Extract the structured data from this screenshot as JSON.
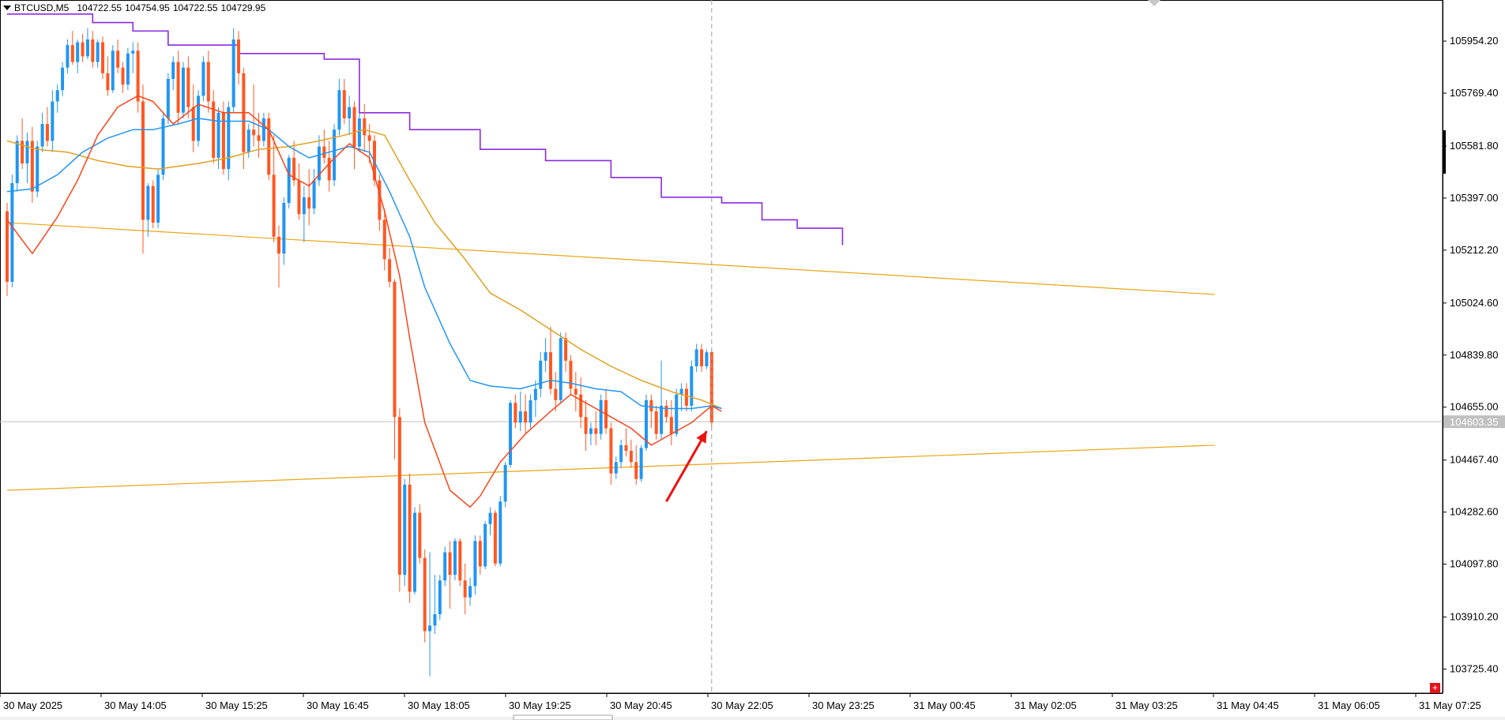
{
  "header": {
    "symbol_timeframe": "BTCUSD,M5",
    "open": "104722.55",
    "high": "104754.95",
    "low": "104722.55",
    "close": "104729.95"
  },
  "colors": {
    "bull": "#2196f3",
    "bear": "#ff5722",
    "ma_fast": "#f7451b",
    "ma_mid": "#2196f3",
    "ma_slow": "#e0a020",
    "trendline": "#e8a614",
    "step_line": "#8a2be2",
    "arrow": "#ee1111",
    "price_line": "#c0c0c0",
    "grid": "#000000"
  },
  "chart_data": {
    "type": "candlestick",
    "symbol": "BTCUSD",
    "timeframe": "M5",
    "ylim": [
      103640,
      106100
    ],
    "price_ticks": [
      "105954.20",
      "105769.40",
      "105581.80",
      "105397.00",
      "105212.20",
      "105024.60",
      "104839.80",
      "104655.00",
      "104467.40",
      "104282.60",
      "104097.80",
      "103910.20",
      "103725.40"
    ],
    "current_price": "104603.35",
    "time_ticks": [
      "30 May 2025",
      "30 May 14:05",
      "30 May 15:25",
      "30 May 16:45",
      "30 May 18:05",
      "30 May 19:25",
      "30 May 20:45",
      "30 May 22:05",
      "30 May 23:25",
      "31 May 00:45",
      "31 May 02:05",
      "31 May 03:25",
      "31 May 04:45",
      "31 May 06:05",
      "31 May 07:25"
    ],
    "candles_first_time": "30 May 2025 12:45",
    "bar_minutes": 5,
    "candles": [
      [
        105350,
        105380,
        105050,
        105100
      ],
      [
        105100,
        105480,
        105080,
        105450
      ],
      [
        105450,
        105620,
        105420,
        105600
      ],
      [
        105600,
        105680,
        105500,
        105520
      ],
      [
        105520,
        105630,
        105450,
        105600
      ],
      [
        105600,
        105650,
        105380,
        105420
      ],
      [
        105420,
        105600,
        105400,
        105580
      ],
      [
        105580,
        105700,
        105560,
        105660
      ],
      [
        105660,
        105720,
        105580,
        105600
      ],
      [
        105600,
        105780,
        105560,
        105740
      ],
      [
        105740,
        105800,
        105700,
        105780
      ],
      [
        105780,
        105880,
        105760,
        105860
      ],
      [
        105860,
        105960,
        105840,
        105940
      ],
      [
        105940,
        105990,
        105870,
        105880
      ],
      [
        105880,
        105960,
        105840,
        105950
      ],
      [
        105950,
        105980,
        105880,
        105900
      ],
      [
        105900,
        106000,
        105890,
        105960
      ],
      [
        105960,
        105990,
        105860,
        105880
      ],
      [
        105880,
        105960,
        105860,
        105950
      ],
      [
        105950,
        105970,
        105820,
        105840
      ],
      [
        105840,
        105900,
        105760,
        105780
      ],
      [
        105780,
        105940,
        105770,
        105920
      ],
      [
        105920,
        105960,
        105840,
        105860
      ],
      [
        105860,
        105880,
        105770,
        105800
      ],
      [
        105800,
        105930,
        105780,
        105910
      ],
      [
        105910,
        105950,
        105840,
        105920
      ],
      [
        105920,
        105950,
        105700,
        105740
      ],
      [
        105740,
        105800,
        105200,
        105320
      ],
      [
        105320,
        105450,
        105260,
        105440
      ],
      [
        105440,
        105460,
        105290,
        105310
      ],
      [
        105310,
        105500,
        105290,
        105480
      ],
      [
        105480,
        105700,
        105460,
        105680
      ],
      [
        105680,
        105840,
        105660,
        105820
      ],
      [
        105820,
        105900,
        105780,
        105880
      ],
      [
        105880,
        105920,
        105660,
        105700
      ],
      [
        105700,
        105880,
        105680,
        105860
      ],
      [
        105860,
        105900,
        105680,
        105720
      ],
      [
        105720,
        105800,
        105560,
        105600
      ],
      [
        105600,
        105780,
        105580,
        105760
      ],
      [
        105760,
        105900,
        105740,
        105880
      ],
      [
        105880,
        105920,
        105700,
        105740
      ],
      [
        105740,
        105780,
        105520,
        105540
      ],
      [
        105540,
        105720,
        105500,
        105700
      ],
      [
        105700,
        105740,
        105480,
        105500
      ],
      [
        105500,
        105740,
        105460,
        105720
      ],
      [
        105720,
        106000,
        105700,
        105960
      ],
      [
        105960,
        105990,
        105800,
        105840
      ],
      [
        105840,
        105860,
        105500,
        105560
      ],
      [
        105560,
        105660,
        105540,
        105640
      ],
      [
        105640,
        105800,
        105580,
        105620
      ],
      [
        105620,
        105700,
        105540,
        105600
      ],
      [
        105600,
        105700,
        105580,
        105680
      ],
      [
        105680,
        105700,
        105460,
        105480
      ],
      [
        105480,
        105620,
        105240,
        105260
      ],
      [
        105260,
        105300,
        105080,
        105200
      ],
      [
        105200,
        105400,
        105160,
        105380
      ],
      [
        105380,
        105550,
        105360,
        105540
      ],
      [
        105540,
        105600,
        105440,
        105460
      ],
      [
        105460,
        105520,
        105320,
        105340
      ],
      [
        105340,
        105440,
        105240,
        105400
      ],
      [
        105400,
        105500,
        105300,
        105360
      ],
      [
        105360,
        105500,
        105340,
        105460
      ],
      [
        105460,
        105620,
        105440,
        105580
      ],
      [
        105580,
        105640,
        105520,
        105540
      ],
      [
        105540,
        105600,
        105420,
        105460
      ],
      [
        105460,
        105660,
        105440,
        105640
      ],
      [
        105640,
        105820,
        105620,
        105780
      ],
      [
        105780,
        105820,
        105660,
        105680
      ],
      [
        105680,
        105760,
        105620,
        105720
      ],
      [
        105720,
        105740,
        105500,
        105580
      ],
      [
        105580,
        105700,
        105560,
        105680
      ],
      [
        105680,
        105730,
        105560,
        105620
      ],
      [
        105620,
        105660,
        105520,
        105600
      ],
      [
        105600,
        105620,
        105440,
        105460
      ],
      [
        105460,
        105480,
        105280,
        105320
      ],
      [
        105320,
        105360,
        105140,
        105180
      ],
      [
        105180,
        105220,
        105080,
        105100
      ],
      [
        105100,
        105110,
        104470,
        104620
      ],
      [
        104620,
        104650,
        104000,
        104060
      ],
      [
        104060,
        104400,
        104020,
        104380
      ],
      [
        104380,
        104420,
        103960,
        104000
      ],
      [
        104000,
        104300,
        103990,
        104280
      ],
      [
        104280,
        104310,
        104100,
        104120
      ],
      [
        104120,
        104150,
        103820,
        103860
      ],
      [
        103860,
        104140,
        103700,
        103880
      ],
      [
        103880,
        104060,
        103850,
        103920
      ],
      [
        103920,
        104060,
        103900,
        104040
      ],
      [
        104040,
        104160,
        104020,
        104140
      ],
      [
        104140,
        104180,
        103940,
        104060
      ],
      [
        104060,
        104190,
        104040,
        104180
      ],
      [
        104180,
        104190,
        104020,
        104040
      ],
      [
        104040,
        104100,
        103920,
        103980
      ],
      [
        103980,
        104050,
        103950,
        104020
      ],
      [
        104020,
        104200,
        103990,
        104180
      ],
      [
        104180,
        104200,
        104060,
        104090
      ],
      [
        104090,
        104250,
        104080,
        104240
      ],
      [
        104240,
        104300,
        104200,
        104280
      ],
      [
        104280,
        104290,
        104090,
        104100
      ],
      [
        104100,
        104340,
        104090,
        104320
      ],
      [
        104320,
        104460,
        104300,
        104450
      ],
      [
        104450,
        104680,
        104440,
        104670
      ],
      [
        104670,
        104700,
        104580,
        104600
      ],
      [
        104600,
        104710,
        104570,
        104640
      ],
      [
        104640,
        104700,
        104560,
        104600
      ],
      [
        104600,
        104700,
        104580,
        104680
      ],
      [
        104680,
        104750,
        104620,
        104720
      ],
      [
        104720,
        104850,
        104690,
        104820
      ],
      [
        104820,
        104900,
        104780,
        104850
      ],
      [
        104850,
        104940,
        104700,
        104720
      ],
      [
        104720,
        104780,
        104640,
        104680
      ],
      [
        104680,
        104920,
        104670,
        104900
      ],
      [
        104900,
        104920,
        104780,
        104820
      ],
      [
        104820,
        104840,
        104700,
        104720
      ],
      [
        104720,
        104780,
        104640,
        104700
      ],
      [
        104700,
        104760,
        104580,
        104620
      ],
      [
        104620,
        104680,
        104500,
        104560
      ],
      [
        104560,
        104600,
        104520,
        104580
      ],
      [
        104580,
        104640,
        104520,
        104560
      ],
      [
        104560,
        104700,
        104540,
        104680
      ],
      [
        104680,
        104720,
        104560,
        104580
      ],
      [
        104580,
        104600,
        104380,
        104420
      ],
      [
        104420,
        104480,
        104400,
        104460
      ],
      [
        104460,
        104540,
        104440,
        104520
      ],
      [
        104520,
        104580,
        104480,
        104500
      ],
      [
        104500,
        104540,
        104440,
        104460
      ],
      [
        104460,
        104520,
        104380,
        104400
      ],
      [
        104400,
        104520,
        104390,
        104510
      ],
      [
        104510,
        104700,
        104500,
        104680
      ],
      [
        104680,
        104700,
        104580,
        104640
      ],
      [
        104640,
        104660,
        104540,
        104560
      ],
      [
        104560,
        104820,
        104540,
        104660
      ],
      [
        104660,
        104680,
        104600,
        104620
      ],
      [
        104620,
        104680,
        104520,
        104560
      ],
      [
        104560,
        104720,
        104550,
        104700
      ],
      [
        104700,
        104740,
        104640,
        104720
      ],
      [
        104720,
        104740,
        104640,
        104660
      ],
      [
        104660,
        104820,
        104640,
        104800
      ],
      [
        104800,
        104880,
        104780,
        104860
      ],
      [
        104860,
        104880,
        104780,
        104800
      ],
      [
        104800,
        104860,
        104790,
        104850
      ],
      [
        104850,
        104860,
        104580,
        104600
      ]
    ],
    "ma_fast": [
      [
        0,
        105320
      ],
      [
        5,
        105200
      ],
      [
        10,
        105330
      ],
      [
        14,
        105460
      ],
      [
        18,
        105620
      ],
      [
        22,
        105720
      ],
      [
        26,
        105760
      ],
      [
        29,
        105740
      ],
      [
        33,
        105660
      ],
      [
        38,
        105730
      ],
      [
        43,
        105700
      ],
      [
        48,
        105700
      ],
      [
        52,
        105640
      ],
      [
        56,
        105480
      ],
      [
        60,
        105440
      ],
      [
        64,
        105520
      ],
      [
        68,
        105590
      ],
      [
        72,
        105540
      ],
      [
        75,
        105350
      ],
      [
        78,
        105120
      ],
      [
        80,
        104900
      ],
      [
        83,
        104600
      ],
      [
        88,
        104360
      ],
      [
        92,
        104300
      ],
      [
        94,
        104340
      ],
      [
        98,
        104460
      ],
      [
        103,
        104560
      ],
      [
        108,
        104640
      ],
      [
        112,
        104700
      ],
      [
        115,
        104670
      ],
      [
        120,
        104620
      ],
      [
        124,
        104580
      ],
      [
        128,
        104520
      ],
      [
        132,
        104560
      ],
      [
        136,
        104600
      ],
      [
        140,
        104660
      ],
      [
        142,
        104640
      ]
    ],
    "ma_mid": [
      [
        0,
        105420
      ],
      [
        5,
        105430
      ],
      [
        10,
        105480
      ],
      [
        15,
        105560
      ],
      [
        20,
        105610
      ],
      [
        25,
        105640
      ],
      [
        29,
        105640
      ],
      [
        34,
        105660
      ],
      [
        38,
        105680
      ],
      [
        42,
        105670
      ],
      [
        48,
        105670
      ],
      [
        52,
        105640
      ],
      [
        56,
        105580
      ],
      [
        60,
        105540
      ],
      [
        64,
        105560
      ],
      [
        68,
        105580
      ],
      [
        72,
        105560
      ],
      [
        76,
        105420
      ],
      [
        80,
        105260
      ],
      [
        83,
        105080
      ],
      [
        88,
        104880
      ],
      [
        92,
        104750
      ],
      [
        96,
        104730
      ],
      [
        102,
        104720
      ],
      [
        108,
        104750
      ],
      [
        112,
        104740
      ],
      [
        117,
        104720
      ],
      [
        122,
        104710
      ],
      [
        126,
        104660
      ],
      [
        131,
        104650
      ],
      [
        136,
        104650
      ],
      [
        140,
        104660
      ],
      [
        142,
        104650
      ]
    ],
    "ma_slow": [
      [
        0,
        105600
      ],
      [
        6,
        105570
      ],
      [
        12,
        105560
      ],
      [
        18,
        105530
      ],
      [
        24,
        105510
      ],
      [
        30,
        105500
      ],
      [
        38,
        105520
      ],
      [
        44,
        105540
      ],
      [
        50,
        105570
      ],
      [
        56,
        105580
      ],
      [
        62,
        105600
      ],
      [
        67,
        105620
      ],
      [
        71,
        105640
      ],
      [
        75,
        105620
      ],
      [
        80,
        105460
      ],
      [
        85,
        105310
      ],
      [
        91,
        105180
      ],
      [
        96,
        105060
      ],
      [
        102,
        105000
      ],
      [
        108,
        104930
      ],
      [
        114,
        104860
      ],
      [
        120,
        104800
      ],
      [
        126,
        104750
      ],
      [
        132,
        104710
      ],
      [
        138,
        104680
      ],
      [
        142,
        104650
      ]
    ],
    "step_line": [
      [
        0,
        106050
      ],
      [
        17,
        106050
      ],
      [
        17,
        106020
      ],
      [
        25,
        106020
      ],
      [
        25,
        105990
      ],
      [
        32,
        105990
      ],
      [
        32,
        105940
      ],
      [
        46,
        105940
      ],
      [
        46,
        105910
      ],
      [
        63,
        105910
      ],
      [
        63,
        105890
      ],
      [
        70,
        105890
      ],
      [
        70,
        105700
      ],
      [
        80,
        105700
      ],
      [
        80,
        105640
      ],
      [
        94,
        105640
      ],
      [
        94,
        105570
      ],
      [
        107,
        105570
      ],
      [
        107,
        105530
      ],
      [
        120,
        105530
      ],
      [
        120,
        105470
      ],
      [
        130,
        105470
      ],
      [
        130,
        105400
      ],
      [
        142,
        105400
      ],
      [
        142,
        105380
      ],
      [
        150,
        105380
      ],
      [
        150,
        105320
      ],
      [
        157,
        105320
      ],
      [
        157,
        105290
      ],
      [
        166,
        105290
      ],
      [
        166,
        105230
      ]
    ],
    "trendline_upper": [
      [
        0,
        105310
      ],
      [
        240,
        105055
      ]
    ],
    "trendline_lower": [
      [
        0,
        104360
      ],
      [
        240,
        104520
      ]
    ],
    "arrow": {
      "from_index": 131,
      "from_price": 104320,
      "to_index": 139,
      "to_price": 104570
    }
  }
}
